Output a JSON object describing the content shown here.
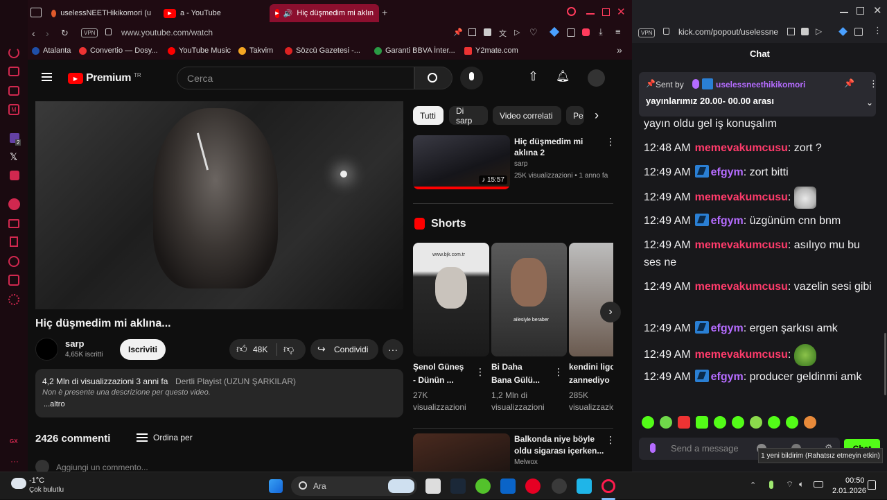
{
  "browser": {
    "tabs": [
      {
        "label": "uselessNEETHikikomori (u"
      },
      {
        "label": "a - YouTube"
      },
      {
        "label": "Hiç düşmedim mi aklın"
      }
    ],
    "vpn": "VPN",
    "url": "www.youtube.com/watch",
    "bookmarks": [
      "Atalanta",
      "Convertio — Dosy...",
      "YouTube Music",
      "Takvim",
      "Sözcü Gazetesi -...",
      "Garanti BBVA İnter...",
      "Y2mate.com"
    ]
  },
  "youtube": {
    "logo_text": "Premium",
    "logo_sup": "TR",
    "search_placeholder": "Cerca",
    "chips": [
      "Tutti",
      "Di sarp",
      "Video correlati",
      "Pe"
    ],
    "video_title": "Hiç düşmedim mi aklına...",
    "channel": {
      "name": "sarp",
      "subs": "4,65K iscritti",
      "subscribe": "Iscriviti"
    },
    "likes": "48K",
    "share": "Condividi",
    "desc": {
      "meta": "4,2 Mln di visualizzazioni  3 anni fa",
      "playlist": "Dertli Playist (UZUN ŞARKILAR)",
      "text": "Non è presente una descrizione per questo video.",
      "more": "...altro"
    },
    "comments": {
      "count": "2426 commenti",
      "sort": "Ordina per",
      "add": "Aggiungi un commento..."
    },
    "rec1": {
      "title_line1": "Hiç düşmedim mi",
      "title_line2": "aklına 2",
      "channel": "sarp",
      "meta": "25K visualizzazioni • 1 anno fa",
      "duration": "15:57"
    },
    "shorts_label": "Shorts",
    "shorts": [
      {
        "title_line1": "Şenol Güneş",
        "title_line2": "- Dünün ...",
        "views_line1": "27K",
        "views_line2": "visualizzazioni"
      },
      {
        "title_line1": "Bi Daha",
        "title_line2": "Bana Gülü...",
        "views_line1": "1,2 Mln di",
        "views_line2": "visualizzazioni"
      },
      {
        "title_line1": "kendini ligo",
        "title_line2": "zannediyo",
        "views_line1": "285K",
        "views_line2": "visualizzazioni"
      }
    ],
    "short_thumb_text": "ailesiyle beraber",
    "short_thumb_text2": "www.bjk.com.tr",
    "rec2": {
      "title_line1": "Balkonda niye böyle",
      "title_line2": "oldu sigarası içerken...",
      "channel": "Melwox"
    }
  },
  "kick": {
    "vpn": "VPN",
    "url": "kick.com/popout/uselessne",
    "chat_title": "Chat",
    "pinned": {
      "sent_by": "Sent by",
      "user": "uselessneethikikomori",
      "text": "yayınlarımız 20.00- 00.00 arası"
    },
    "partial_top": "yayın oldu gel iş konuşalım",
    "messages": [
      {
        "time": "12:48 AM",
        "user": "memevakumcusu",
        "text": ": zort ?",
        "color": "red"
      },
      {
        "time": "12:49 AM",
        "user": "efgym",
        "text": ": zort bitti",
        "color": "purple"
      },
      {
        "time": "12:49 AM",
        "user": "memevakumcusu",
        "text": ":",
        "color": "red"
      },
      {
        "time": "12:49 AM",
        "user": "efgym",
        "text": ": üzgünüm cnn bnm",
        "color": "purple"
      },
      {
        "time": "12:49 AM",
        "user": "memevakumcusu",
        "text": ": asılıyo mu bu ses ne",
        "color": "red"
      },
      {
        "time": "12:49 AM",
        "user": "memevakumcusu",
        "text": ": vazelin sesi gibi",
        "color": "red"
      },
      {
        "time": "12:49 AM",
        "user": "efgym",
        "text": ": ergen şarkısı amk",
        "color": "purple"
      },
      {
        "time": "12:49 AM",
        "user": "memevakumcusu",
        "text": ":",
        "color": "red"
      },
      {
        "time": "12:49 AM",
        "user": "efgym",
        "text": ": producer geldinmi amk",
        "color": "purple"
      }
    ],
    "send_placeholder": "Send a message",
    "chat_button": "Chat",
    "tooltip": "1 yeni bildirim (Rahatsız etmeyin etkin)"
  },
  "taskbar": {
    "temp": "-1°C",
    "weather": "Çok bulutlu",
    "search": "Ara",
    "time": "00:50",
    "date": "2.01.2026"
  },
  "colors": {
    "yt_red": "#ff0000",
    "kick_green": "#53fc18",
    "opera_red": "#8b0f2e",
    "user_red": "#ff3b6b",
    "user_purple": "#b56cff"
  }
}
